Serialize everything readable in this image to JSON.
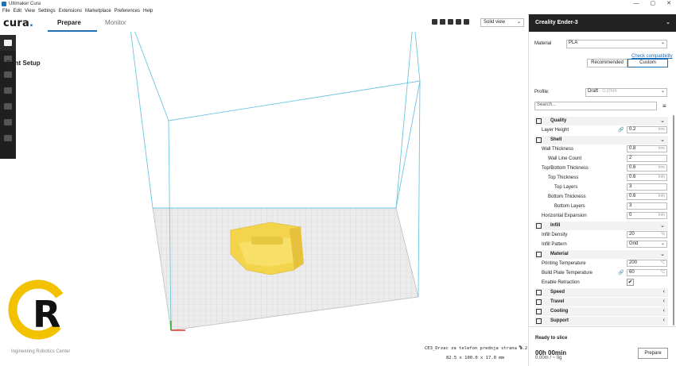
{
  "window": {
    "title": "Ultimaker Cura",
    "controls": [
      "—",
      "▢",
      "✕"
    ]
  },
  "menu": [
    "File",
    "Edit",
    "View",
    "Settings",
    "Extensions",
    "Marketplace",
    "Preferences",
    "Help"
  ],
  "header": {
    "logo": "cura",
    "tabs": [
      {
        "label": "Prepare",
        "active": true
      },
      {
        "label": "Monitor",
        "active": false
      }
    ],
    "view_mode": "Solid view"
  },
  "left_tools": [
    "open-file-icon",
    "move-icon",
    "scale-icon",
    "rotate-icon",
    "mirror-icon",
    "per-model-settings-icon",
    "support-blocker-icon"
  ],
  "printer": {
    "name": "Creality Ender-3",
    "material_label": "Material",
    "material_value": "PLA",
    "check_compat": "Check compatibility"
  },
  "print_setup": {
    "title": "Print Setup",
    "mode_recommended": "Recommended",
    "mode_custom": "Custom",
    "profile_label": "Profile:",
    "profile_value": "Draft",
    "profile_hint": "- 0.2mm",
    "search_placeholder": "Search..."
  },
  "sections": [
    {
      "title": "Quality",
      "icon": "quality-icon",
      "expanded": true
    },
    {
      "title": "Shell",
      "icon": "shell-icon",
      "expanded": true
    },
    {
      "title": "Infill",
      "icon": "infill-icon",
      "expanded": true
    },
    {
      "title": "Material",
      "icon": "material-icon",
      "expanded": true
    },
    {
      "title": "Speed",
      "icon": "speed-icon",
      "expanded": false
    },
    {
      "title": "Travel",
      "icon": "travel-icon",
      "expanded": false
    },
    {
      "title": "Cooling",
      "icon": "cooling-icon",
      "expanded": false
    },
    {
      "title": "Support",
      "icon": "support-icon",
      "expanded": false
    }
  ],
  "settings": {
    "layer_height": {
      "label": "Layer Height",
      "value": "0.2",
      "unit": "mm"
    },
    "wall_thickness": {
      "label": "Wall Thickness",
      "value": "0.8",
      "unit": "mm"
    },
    "wall_line_count": {
      "label": "Wall Line Count",
      "value": "2"
    },
    "top_bottom_thickness": {
      "label": "Top/Bottom Thickness",
      "value": "0.6",
      "unit": "mm"
    },
    "top_thickness": {
      "label": "Top Thickness",
      "value": "0.6",
      "unit": "mm"
    },
    "top_layers": {
      "label": "Top Layers",
      "value": "3"
    },
    "bottom_thickness": {
      "label": "Bottom Thickness",
      "value": "0.6",
      "unit": "mm"
    },
    "bottom_layers": {
      "label": "Bottom Layers",
      "value": "3"
    },
    "horizontal_expansion": {
      "label": "Horizontal Expansion",
      "value": "0",
      "unit": "mm"
    },
    "infill_density": {
      "label": "Infill Density",
      "value": "20",
      "unit": "%"
    },
    "infill_pattern": {
      "label": "Infill Pattern",
      "value": "Grid"
    },
    "printing_temperature": {
      "label": "Printing Temperature",
      "value": "200",
      "unit": "°C"
    },
    "build_plate_temperature": {
      "label": "Build Plate Temperature",
      "value": "60",
      "unit": "°C"
    },
    "enable_retraction": {
      "label": "Enable Retraction",
      "value": "✔"
    }
  },
  "footer": {
    "status": "Ready to slice",
    "time": "00h 00min",
    "material": "0.00m / ~ 0g",
    "prepare_button": "Prepare",
    "object_name": "CE3_Drzac za telefon prednja strana 1.2",
    "object_dims": "82.5 x 100.0 x 17.0 mm"
  },
  "overlay": {
    "caption": "Ingineering Robotics Center",
    "logo_letters": "CR"
  },
  "colors": {
    "accent": "#1f6fb5",
    "model": "#f5d84a",
    "volume_lines": "#6ec6e0",
    "plate": "#e8e8e8"
  }
}
